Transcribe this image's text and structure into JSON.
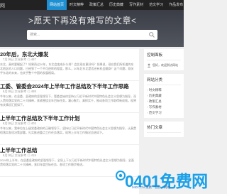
{
  "header": {
    "logo": "网",
    "nav": [
      "网站首页",
      "时文精粹",
      "政策汇总",
      "历史典藏",
      "写作素材",
      "范文学习",
      "作品发布"
    ]
  },
  "hero": {
    "title": ">愿天下再没有难写的文章<",
    "search_placeholder": "搜索..."
  },
  "articles": [
    {
      "title": "20年后，东北大爆发",
      "meta": "7月16日  文化参考  ◎ 467",
      "excerpt": "东北，真的要崛起了？如果再过20年，东北会变成什么样？会比现在更好吗？如果说，现在我们所知道的东北地区的人口问题，已经到了一个不可逆转的程度，那么，20年后东北是否还有机会翻身？这个问题，既关乎东北的未来，也关乎整个中国的发展格局。"
    },
    {
      "title": "工委、管委会2024年上半年工作总结及下半年工作思路",
      "meta": "6月18日  文化参考  ◎ 488",
      "excerpt": "今年以来，在县委、县政府的坚强领导下，管委会始终坚持以习近平新时代中国特色社会主义思想为指导，深入贯彻落实党的二十大精神，紧紧围绕全年目标任务，凝心聚力、真抓实干，推动各项工作取得新成效。现将有关情况汇报如下。"
    },
    {
      "title": "上半年工作总结及下半年工作计划",
      "meta": "6月18日  文化参考  ◎ 403",
      "excerpt": "今年以来，我单位在上级党委政府的正确领导下，坚持以习近平新时代中国特色社会主义思想为指导，认真贯彻落实各项决策部署，扎实推进重点工作任务落实，现将上半年工作情况总结如下。"
    },
    {
      "title": "上半年工作总结",
      "meta": "6月18日  文化参考  ◎ 419",
      "excerpt": "2024年上半年，在县委县政府的坚强领导下，全局上下以习近平新时代中国特色社会主义思想为指导，全面贯彻落实党的二十大精神，紧扣年度目标任务，各项工作稳步推进。"
    }
  ],
  "sidebar": {
    "control_title": "控制面板",
    "control_text": "您好，欢迎到访网站",
    "control_note": "",
    "cat_title": "网站分类",
    "categories": [
      "时文精粹",
      "历史典藏",
      "政策汇总",
      "写作素材",
      "范文学习"
    ],
    "hot_title": "热门文章"
  },
  "watermark": {
    "text": "0401免费网",
    "sub": "0401.CN  免费 · 低价 · 网站"
  },
  "colors": {
    "accent": "#1e8fd1",
    "topbar": "#222222"
  }
}
